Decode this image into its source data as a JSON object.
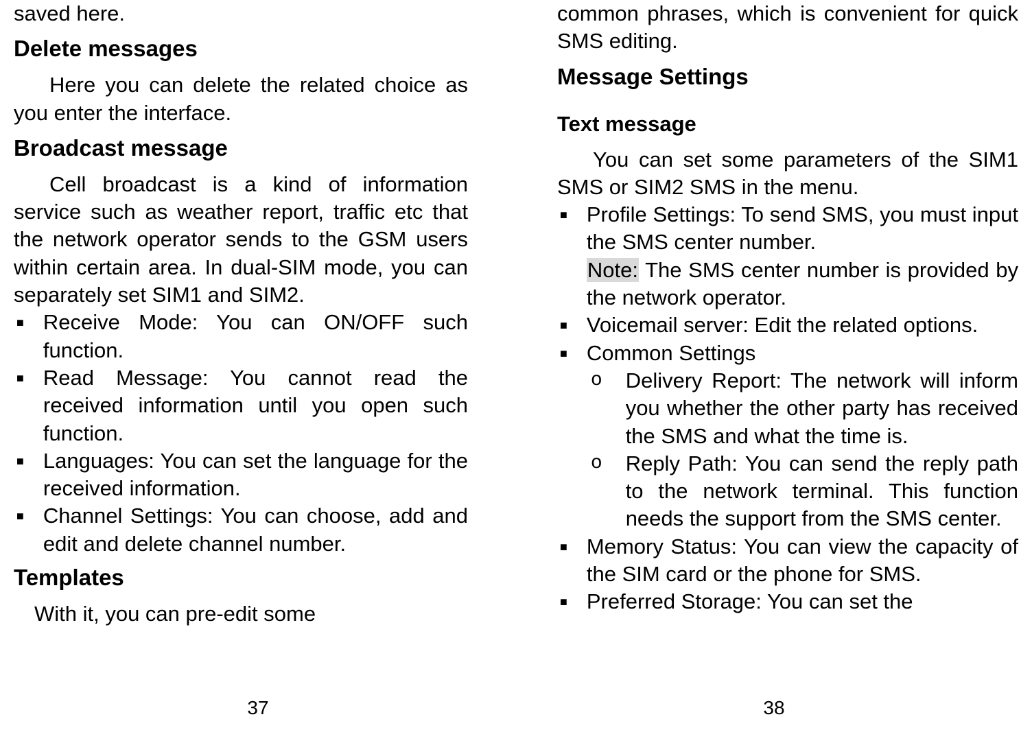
{
  "left_page": {
    "line_saved": "saved here.",
    "heading_delete": "Delete messages",
    "para_delete": "Here you can delete the related choice as you enter the interface.",
    "heading_broadcast": "Broadcast message",
    "para_broadcast": "Cell broadcast is a kind of information service such as weather report, traffic etc that the network operator sends to the GSM users within certain area. In dual-SIM mode, you can separately set SIM1 and SIM2.",
    "broadcast_items": [
      "Receive Mode: You can ON/OFF such function.",
      "Read Message: You cannot read the received information until you open such function.",
      "Languages: You can set the language for the received information.",
      "Channel Settings: You can choose, add and edit and delete channel number."
    ],
    "heading_templates": "Templates",
    "para_templates": "With it, you can pre-edit some",
    "page_no": "37"
  },
  "right_page": {
    "line_common": "common phrases, which is convenient for quick SMS editing.",
    "heading_settings": "Message Settings",
    "subheading_text": "Text message",
    "para_text": "You can set some parameters of the SIM1 SMS or SIM2 SMS in the menu.",
    "profile_line": "Profile Settings: To send SMS, you must input the SMS center number.",
    "profile_note_label": "Note:",
    "profile_note_rest": " The SMS center number is provided by the network operator.",
    "voicemail_line": "Voicemail server: Edit the related options.",
    "common_settings_label": "Common Settings",
    "common_subitems": [
      "Delivery Report: The network will inform you whether the other party has received the SMS and what the time is.",
      "Reply Path: You can send the reply path to the network terminal. This function needs the support from the SMS center."
    ],
    "memory_line": "Memory Status: You can view the capacity of the SIM card or the phone for SMS.",
    "preferred_line": "Preferred Storage: You can set the",
    "page_no": "38"
  }
}
